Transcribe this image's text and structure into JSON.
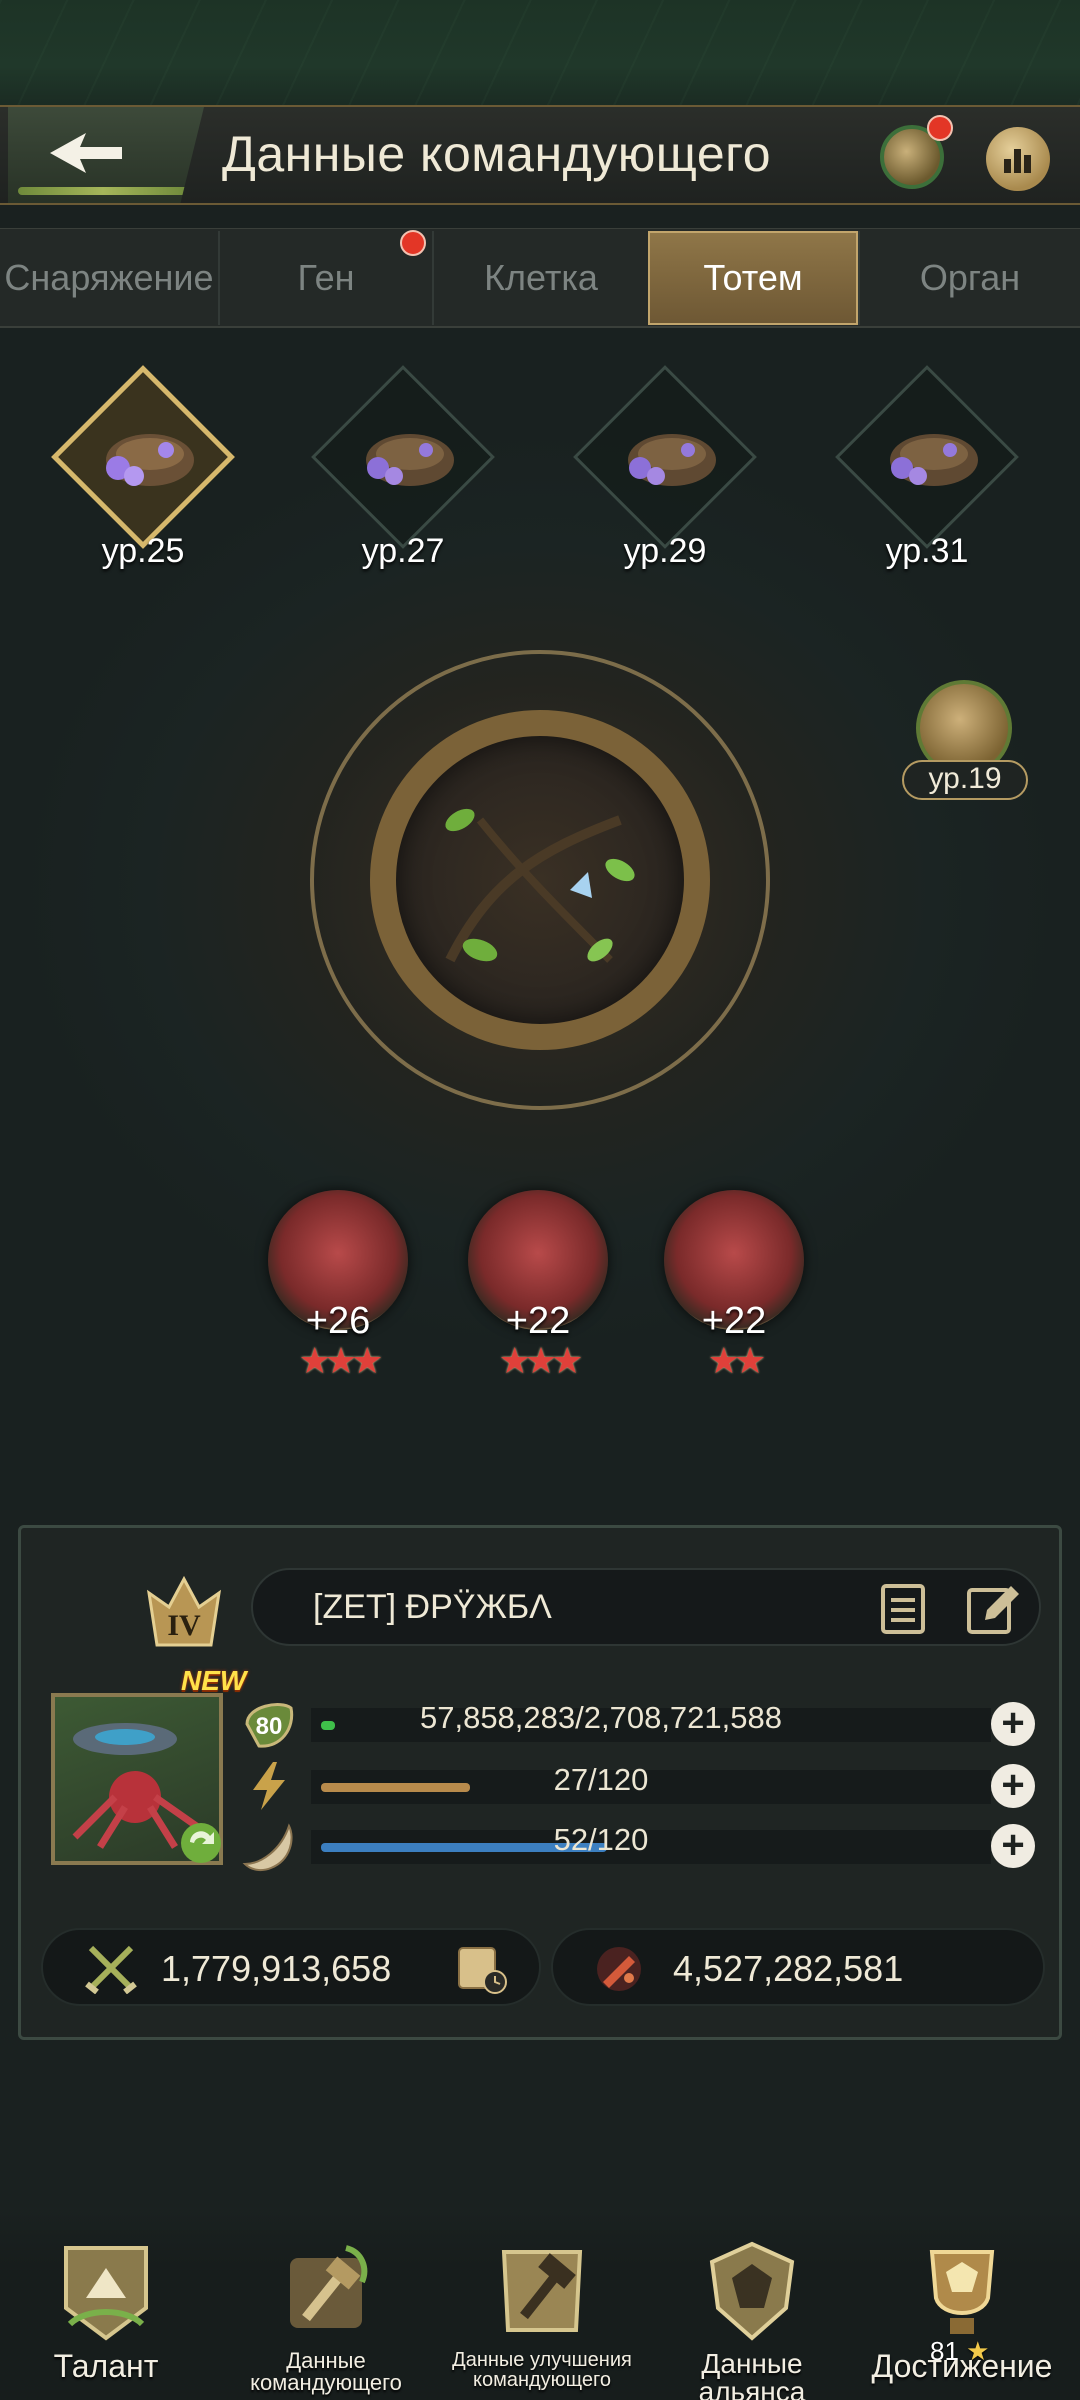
{
  "header": {
    "title": "Данные командующего"
  },
  "tabs": [
    {
      "label": "Снаряжение",
      "active": false
    },
    {
      "label": "Ген",
      "active": false,
      "has_notification": true
    },
    {
      "label": "Клетка",
      "active": false
    },
    {
      "label": "Тотем",
      "active": true
    },
    {
      "label": "Орган",
      "active": false
    }
  ],
  "totem_slots": [
    {
      "level": "ур.25",
      "selected": true
    },
    {
      "level": "ур.27",
      "selected": false
    },
    {
      "level": "ур.29",
      "selected": false
    },
    {
      "level": "ур.31",
      "selected": false
    }
  ],
  "side_badge": {
    "level": "ур.19"
  },
  "attributes": [
    {
      "value": "+26",
      "stars": 3,
      "icon": "claw-icon"
    },
    {
      "value": "+22",
      "stars": 3,
      "icon": "gem-icon"
    },
    {
      "value": "+22",
      "stars": 2,
      "icon": "heart-icon"
    }
  ],
  "commander": {
    "rank": "IV",
    "name": "[ZET]  ÐΡŸЖБΛ",
    "new_badge": "NEW",
    "level": "80",
    "exp": {
      "text": "57,858,283/2,708,721,588",
      "fraction": 0.021
    },
    "energy": {
      "text": "27/120",
      "fraction": 0.225
    },
    "stamina": {
      "text": "52/120",
      "fraction": 0.433
    },
    "power": "1,779,913,658",
    "kills": "4,527,282,581"
  },
  "bottom_nav": [
    {
      "label": "Талант"
    },
    {
      "label": "Данные командующего"
    },
    {
      "label": "Данные улучшения командующего"
    },
    {
      "label": "Данные альянса"
    },
    {
      "label": "Достижение",
      "count": "81"
    }
  ],
  "colors": {
    "accent_gold": "#c2a56c",
    "notification_red": "#e33626",
    "exp_bar": "#3fbf4a",
    "energy_bar": "#b88b4c",
    "stamina_bar": "#3c7fc0"
  }
}
